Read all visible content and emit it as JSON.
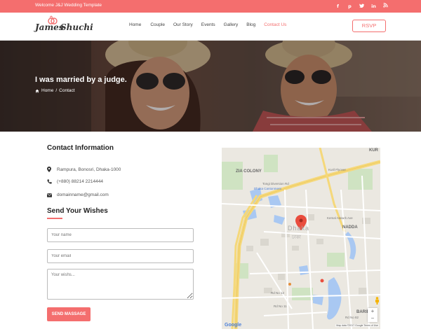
{
  "topbar": {
    "welcome": "Welcome J&J Wedding Template",
    "social": [
      {
        "icon": "facebook-icon",
        "glyph": "f"
      },
      {
        "icon": "pinterest-icon",
        "glyph": "p"
      },
      {
        "icon": "twitter-icon",
        "glyph": "t"
      },
      {
        "icon": "linkedin-icon",
        "glyph": "in"
      },
      {
        "icon": "rss-icon",
        "glyph": "◉"
      }
    ]
  },
  "header": {
    "logo_left": "James",
    "logo_right": "Shuchi",
    "menu": [
      "Home",
      "Couple",
      "Our Story",
      "Events",
      "Gallery",
      "Blog",
      "Contact Us"
    ],
    "active_menu": "Contact Us",
    "rsvp_label": "RSVP"
  },
  "hero": {
    "title": "I was married by a judge.",
    "breadcrumb_home": "Home",
    "breadcrumb_sep": "/",
    "breadcrumb_current": "Contact"
  },
  "contact": {
    "title": "Contact Information",
    "address": "Rampura, Bonosri, Dhaka-1000",
    "phone": "(+880) 88214 2214444",
    "email": "domainname@gmail.com"
  },
  "form": {
    "title": "Send Your Wishes",
    "name_placeholder": "Your name",
    "email_placeholder": "Your email",
    "wishes_placeholder": "Your wishs...",
    "submit_label": "SEND MASSAGE"
  },
  "map": {
    "labels": {
      "zia_colony": "ZIA COLONY",
      "nadda": "NADDA",
      "baridhara": "BARIDHA",
      "kur": "KUR",
      "dhaka": "Dhaka",
      "dhaka_bn": "ঢাকা",
      "tongi_road": "Tongi Diversion Rd",
      "kuril_flyover": "Kuril Flyover",
      "dhaka_cantonment": "Dhaka Cantonment",
      "kemal_ataturk": "Kemal Ataturk Ave",
      "road_12": "Rd No 12",
      "road_11": "Rd No 11",
      "road_82": "Rd No 82"
    },
    "google": "Google",
    "attribution": "Map data ©2017 Google   Terms of Use",
    "zoom_in": "+",
    "zoom_out": "−"
  },
  "colors": {
    "accent": "#f46e6e"
  }
}
